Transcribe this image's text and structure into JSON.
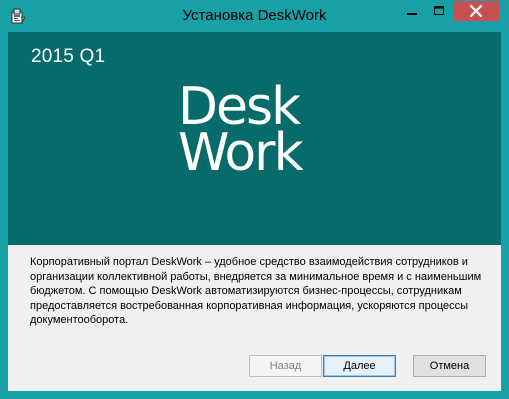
{
  "window": {
    "title": "Установка DeskWork",
    "icon": "installer-icon"
  },
  "caption_buttons": {
    "minimize_icon": "minimize-icon",
    "maximize_icon": "maximize-icon",
    "close_icon": "close-icon"
  },
  "banner": {
    "version": "2015 Q1",
    "logo_line1": "Desk",
    "logo_line2": "Work",
    "background": "#076b6c"
  },
  "description": "Корпоративный портал DeskWork – удобное средство взаимодействия сотрудников и организации коллективной работы, внедряется за минимальное время и с наименьшим бюджетом. С помощью DeskWork автоматизируются бизнес-процессы, сотрудникам предоставляется востребованная корпоративная информация, ускоряются процессы документооборота.",
  "buttons": {
    "back": "Назад",
    "back_enabled": false,
    "next": "Далее",
    "cancel": "Отмена"
  },
  "colors": {
    "frame": "#17a0a5",
    "close_button": "#c75050",
    "content_bg": "#f0f0f0"
  }
}
